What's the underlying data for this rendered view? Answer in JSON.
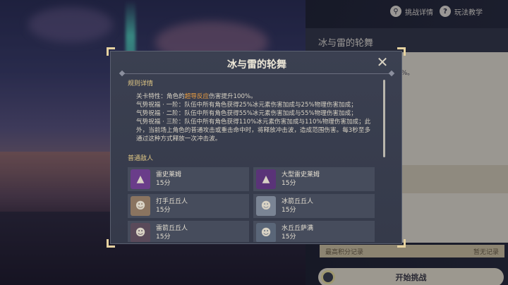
{
  "header_links": {
    "challenge_details": "挑战详情",
    "tutorial": "玩法教学",
    "help_glyph": "?"
  },
  "right_panel": {
    "title": "冰与雷的轮舞",
    "partial_text": "0%。",
    "best_score_label": "最高积分记录",
    "best_score_value": "暂无记录",
    "start_button": "开始挑战"
  },
  "dialog": {
    "title": "冰与雷的轮舞",
    "close_glyph": "✕",
    "rules_heading": "规则详情",
    "rules_intro": "关卡特性：角色的",
    "rules_highlight": "超导反应",
    "rules_intro_end": "伤害提升100%。",
    "rules_lines": [
      "气势祝福 · 一阶：队伍中所有角色获得25%冰元素伤害加成与25%物理伤害加成；",
      "气势祝福 · 二阶：队伍中所有角色获得55%冰元素伤害加成与55%物理伤害加成；",
      "气势祝福 · 三阶：队伍中所有角色获得110%冰元素伤害加成与110%物理伤害加成；此外，当前场上角色的普通攻击或重击命中时，将释放冲击波，造成范围伤害。每3秒至多通过这种方式释放一次冲击波。"
    ],
    "enemies_heading": "普通敌人",
    "enemies": [
      {
        "name": "雷史莱姆",
        "score": "15分",
        "icon": "electro-slime-icon",
        "color": "#6a3d8a"
      },
      {
        "name": "大型雷史莱姆",
        "score": "15分",
        "icon": "large-electro-slime-icon",
        "color": "#5a3378"
      },
      {
        "name": "打手丘丘人",
        "score": "15分",
        "icon": "hilichurl-fighter-icon",
        "color": "#8a7460"
      },
      {
        "name": "冰箭丘丘人",
        "score": "15分",
        "icon": "cryo-hilichurl-shooter-icon",
        "color": "#7a8494"
      },
      {
        "name": "雷箭丘丘人",
        "score": "15分",
        "icon": "electro-hilichurl-shooter-icon",
        "color": "#5a4a5a"
      },
      {
        "name": "水丘丘萨满",
        "score": "15分",
        "icon": "hydro-samachurl-icon",
        "color": "#5a6678"
      }
    ]
  }
}
